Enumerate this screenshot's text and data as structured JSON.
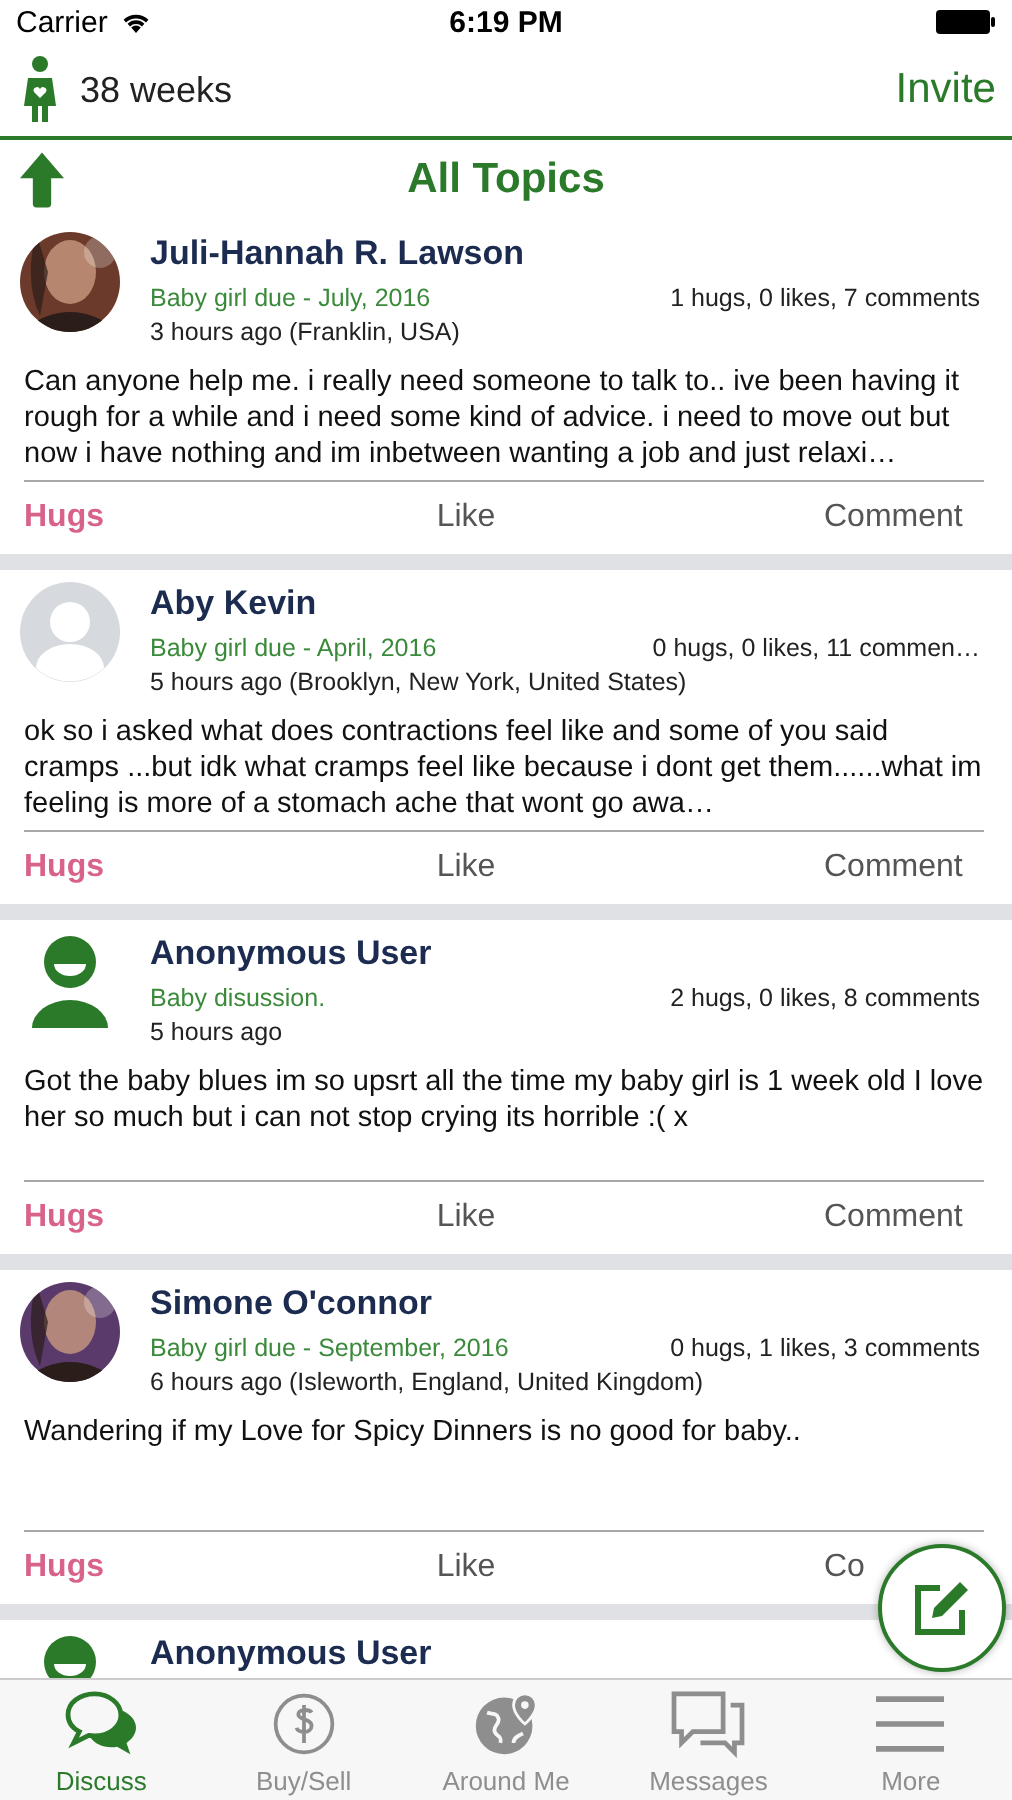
{
  "status_bar": {
    "carrier": "Carrier",
    "time": "6:19 PM"
  },
  "nav": {
    "weeks": "38 weeks",
    "action": "Invite"
  },
  "header": {
    "title": "All Topics"
  },
  "posts": [
    {
      "name": "Juli-Hannah R. Lawson",
      "due": "Baby girl due - July, 2016",
      "stats": "1 hugs, 0 likes, 7 comments",
      "time": "3 hours ago (Franklin, USA)",
      "body": "Can anyone help me. i really need someone to talk to.. ive been having it rough for a while and i need some kind of advice. i need to move out but now i have nothing and im inbetween wanting a job and just relaxi…",
      "actions": [
        "Hugs",
        "Like",
        "Comment"
      ]
    },
    {
      "kind": "placeholder",
      "name": "Aby Kevin",
      "due": "Baby girl due - April, 2016",
      "stats": "0 hugs, 0 likes, 11 commen…",
      "time": "5 hours ago (Brooklyn, New York, United States)",
      "body": "ok so i asked what does contractions feel like and some of you said cramps ...but idk what cramps feel like because i dont get them......what im feeling is more of a stomach ache that wont go awa…",
      "actions": [
        "Hugs",
        "Like",
        "Comment"
      ]
    },
    {
      "kind": "anonymous",
      "name": "Anonymous User",
      "due": "Baby disussion.",
      "stats": "2 hugs, 0 likes, 8 comments",
      "time": "5 hours ago",
      "body": "Got the baby blues im so upsrt all the time my baby girl is 1 week old I love her so much but i can not stop crying its horrible :( x",
      "actions": [
        "Hugs",
        "Like",
        "Comment"
      ]
    },
    {
      "name": "Simone O'connor",
      "due": "Baby girl due - September, 2016",
      "stats": "0 hugs, 1 likes, 3 comments",
      "time": "6 hours ago (Isleworth, England, United Kingdom)",
      "body": "Wandering if my Love for Spicy Dinners is no good for baby..",
      "actions": [
        "Hugs",
        "Like",
        "Co"
      ]
    },
    {
      "kind": "anonymous",
      "name": "Anonymous User"
    }
  ],
  "tabs": [
    {
      "label": "Discuss",
      "selected": true
    },
    {
      "label": "Buy/Sell",
      "selected": false
    },
    {
      "label": "Around Me",
      "selected": false
    },
    {
      "label": "Messages",
      "selected": false
    },
    {
      "label": "More",
      "selected": false
    }
  ]
}
